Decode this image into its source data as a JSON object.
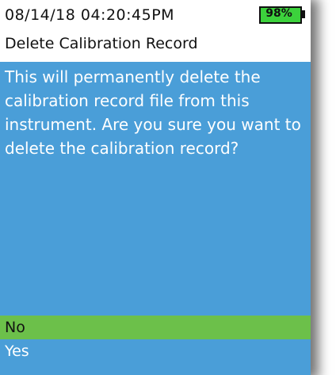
{
  "status": {
    "datetime": "08/14/18 04:20:45PM",
    "battery": "98%"
  },
  "title": "Delete Calibration Record",
  "message": "This will permanently delete the calibration record file from this instrument.  Are you sure you want to delete the calibration record?",
  "options": [
    {
      "label": "No",
      "selected": true
    },
    {
      "label": "Yes",
      "selected": false
    }
  ],
  "colors": {
    "background": "#4a9ed8",
    "selected": "#6cc04a",
    "battery": "#3cd23c"
  }
}
